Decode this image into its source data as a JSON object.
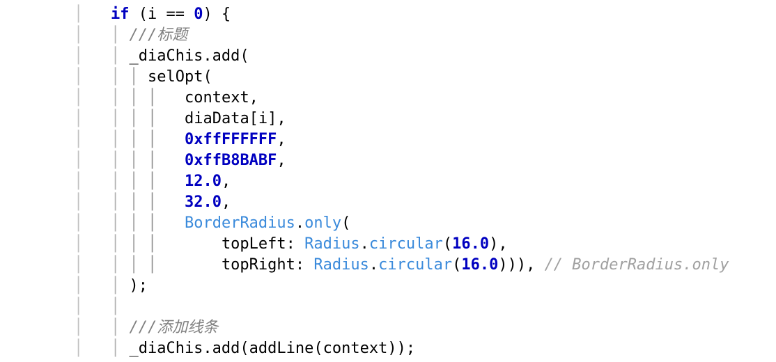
{
  "code": {
    "l1": {
      "gut": "        ",
      "g2": "│",
      "sp1": "   ",
      "kw_if": "if",
      "sp2": " (i == ",
      "num_zero": "0",
      "tail": ") {"
    },
    "l2": {
      "gut": "        ",
      "g2": "│",
      "sp1": "   ",
      "g3": "│",
      "sp2": " ",
      "cmt": "///标题"
    },
    "l3": {
      "gut": "        ",
      "g2": "│",
      "sp1": "   ",
      "g3": "│",
      "sp2": " ",
      "txt": "_diaChis.add("
    },
    "l4": {
      "gut": "        ",
      "g2": "│",
      "sp1": "   ",
      "g3": "│",
      "sp2": " ",
      "g4": "│",
      "sp3": " ",
      "txt": "selOpt("
    },
    "l5": {
      "gut": "        ",
      "g2": "│",
      "sp1": "   ",
      "g3": "│",
      "sp2": " ",
      "g4": "│",
      "sp3": " ",
      "g5": "│",
      "sp4": "   ",
      "txt": "context,"
    },
    "l6": {
      "gut": "        ",
      "g2": "│",
      "sp1": "   ",
      "g3": "│",
      "sp2": " ",
      "g4": "│",
      "sp3": " ",
      "g5": "│",
      "sp4": "   ",
      "txt": "diaData[i],"
    },
    "l7": {
      "gut": "        ",
      "g2": "│",
      "sp1": "   ",
      "g3": "│",
      "sp2": " ",
      "g4": "│",
      "sp3": " ",
      "g5": "│",
      "sp4": "   ",
      "num": "0xffFFFFFF",
      "tail": ","
    },
    "l8": {
      "gut": "        ",
      "g2": "│",
      "sp1": "   ",
      "g3": "│",
      "sp2": " ",
      "g4": "│",
      "sp3": " ",
      "g5": "│",
      "sp4": "   ",
      "num": "0xffB8BABF",
      "tail": ","
    },
    "l9": {
      "gut": "        ",
      "g2": "│",
      "sp1": "   ",
      "g3": "│",
      "sp2": " ",
      "g4": "│",
      "sp3": " ",
      "g5": "│",
      "sp4": "   ",
      "num": "12.0",
      "tail": ","
    },
    "l10": {
      "gut": "        ",
      "g2": "│",
      "sp1": "   ",
      "g3": "│",
      "sp2": " ",
      "g4": "│",
      "sp3": " ",
      "g5": "│",
      "sp4": "   ",
      "num": "32.0",
      "tail": ","
    },
    "l11": {
      "gut": "        ",
      "g2": "│",
      "sp1": "   ",
      "g3": "│",
      "sp2": " ",
      "g4": "│",
      "sp3": " ",
      "g5": "│",
      "sp4": "   ",
      "type": "BorderRadius",
      "dot": ".",
      "call": "only",
      "tail": "("
    },
    "l12": {
      "gut": "        ",
      "g2": "│",
      "sp1": "   ",
      "g3": "│",
      "sp2": " ",
      "g4": "│",
      "sp3": " ",
      "g5": "│",
      "sp4": "       ",
      "pre": "topLeft: ",
      "type": "Radius",
      "dot": ".",
      "call": "circular",
      "open": "(",
      "num": "16.0",
      "tail": "),"
    },
    "l13": {
      "gut": "        ",
      "g2": "│",
      "sp1": "   ",
      "g3": "│",
      "sp2": " ",
      "g4": "│",
      "sp3": " ",
      "g5": "│",
      "sp4": "       ",
      "pre": "topRight: ",
      "type": "Radius",
      "dot": ".",
      "call": "circular",
      "open": "(",
      "num": "16.0",
      "tail": "))), ",
      "cmt2": "// BorderRadius.only"
    },
    "l14": {
      "gut": "        ",
      "g2": "│",
      "sp1": "   ",
      "g3": "│",
      "sp2": " ",
      "txt": ");"
    },
    "l15": {
      "gut": "        ",
      "g2": "│",
      "sp1": "   ",
      "g3": "│",
      "sp2": " "
    },
    "l16": {
      "gut": "        ",
      "g2": "│",
      "sp1": "   ",
      "g3": "│",
      "sp2": " ",
      "cmt": "///添加线条"
    },
    "l17": {
      "gut": "        ",
      "g2": "│",
      "sp1": "   ",
      "g3": "│",
      "sp2": " ",
      "txt": "_diaChis.add(addLine(context));"
    }
  }
}
